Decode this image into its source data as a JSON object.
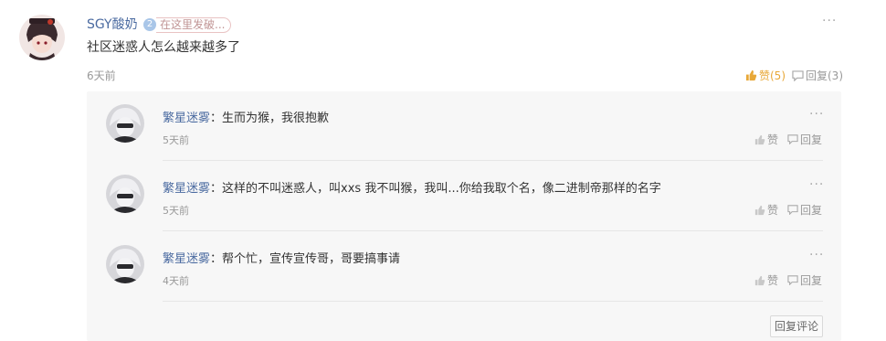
{
  "main_comment": {
    "username": "SGY酸奶",
    "level": "2",
    "title_badge": "在这里发破...",
    "content": "社区迷惑人怎么越来越多了",
    "time": "6天前",
    "like_label": "赞(5)",
    "reply_label": "回复(3)",
    "more": "···"
  },
  "replies": [
    {
      "name": "繁星迷雾",
      "separator": "：",
      "content": "生而为猴，我很抱歉",
      "time": "5天前",
      "like_label": "赞",
      "reply_label": "回复",
      "more": "···"
    },
    {
      "name": "繁星迷雾",
      "separator": "：",
      "content": "这样的不叫迷惑人，叫xxs 我不叫猴，我叫...你给我取个名，像二进制帝那样的名字",
      "time": "5天前",
      "like_label": "赞",
      "reply_label": "回复",
      "more": "···"
    },
    {
      "name": "繁星迷雾",
      "separator": "：",
      "content": "帮个忙，宣传宣传哥，哥要搞事请",
      "time": "4天前",
      "like_label": "赞",
      "reply_label": "回复",
      "more": "···"
    }
  ],
  "reply_button_label": "回复评论",
  "colors": {
    "username": "#4a6aa0",
    "like_active": "#e8a838",
    "muted": "#999999",
    "reply_bg": "#f7f7f7"
  }
}
